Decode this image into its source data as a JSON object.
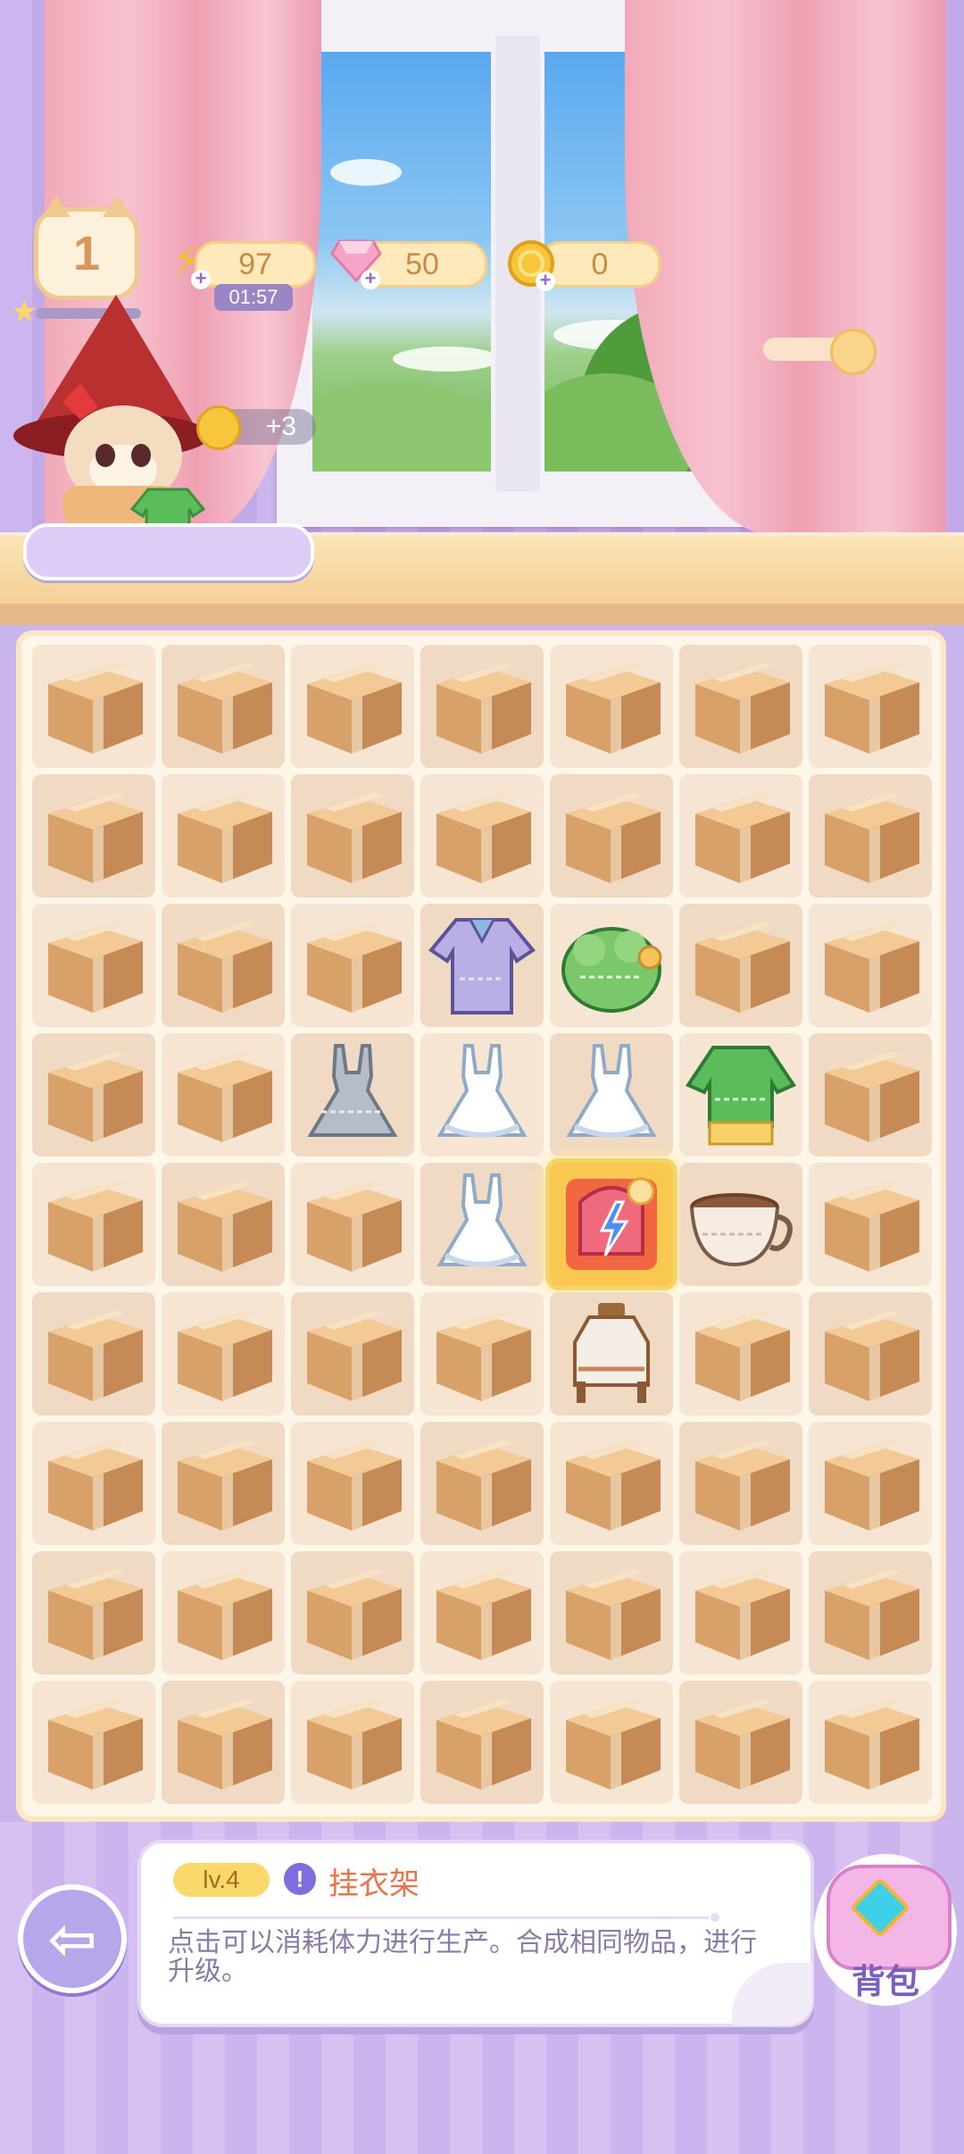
{
  "hud": {
    "level": "1",
    "energy": {
      "value": "97",
      "timer": "01:57",
      "icon": "lightning-icon"
    },
    "gems": {
      "value": "50",
      "icon": "pink-gem-icon"
    },
    "coins": {
      "value": "0",
      "icon": "gold-coin-icon"
    },
    "order_reward": "+3"
  },
  "board": {
    "rows": 9,
    "cols": 7,
    "items": [
      [
        "box",
        "box",
        "box",
        "box",
        "box",
        "box",
        "box"
      ],
      [
        "box",
        "box",
        "box",
        "box",
        "box",
        "box",
        "box"
      ],
      [
        "box",
        "box",
        "box",
        "purple-coat",
        "green-hat",
        "box",
        "box"
      ],
      [
        "box",
        "box",
        "grey-dress",
        "white-dress",
        "white-dress",
        "green-sweater",
        "box"
      ],
      [
        "box",
        "box",
        "box",
        "white-dress",
        "clothes-rack",
        "coffee-cup",
        "box"
      ],
      [
        "box",
        "box",
        "box",
        "box",
        "bottle-cart",
        "box",
        "box"
      ],
      [
        "box",
        "box",
        "box",
        "box",
        "box",
        "box",
        "box"
      ],
      [
        "box",
        "box",
        "box",
        "box",
        "box",
        "box",
        "box"
      ],
      [
        "box",
        "box",
        "box",
        "box",
        "box",
        "box",
        "box"
      ]
    ],
    "selected": [
      4,
      4
    ]
  },
  "info_panel": {
    "level_label": "lv.4",
    "item_name": "挂衣架",
    "description": "点击可以消耗体力进行生产。合成相同物品，进行升级。"
  },
  "bag": {
    "label": "背包"
  },
  "colors": {
    "accent": "#b8a6ea",
    "selected_cell": "#f8c850",
    "cell_bg": "#f6e5d3"
  }
}
